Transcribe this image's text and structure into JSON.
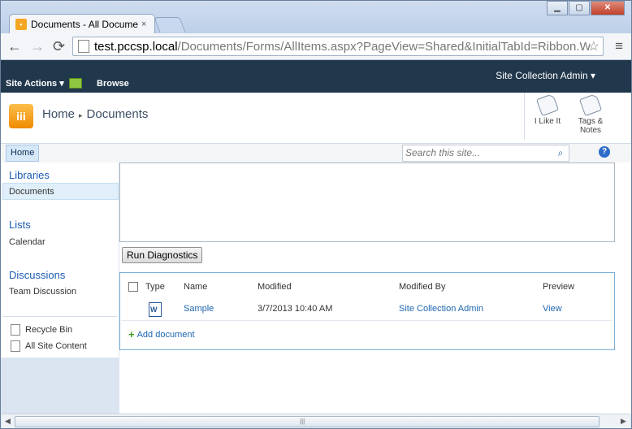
{
  "browser": {
    "tab_title": "Documents - All Documer",
    "tab_close": "×",
    "window_controls": [
      "▁",
      "▢",
      "✕"
    ],
    "url_host": "test.pccsp.local",
    "url_path": "/Documents/Forms/AllItems.aspx?PageView=Shared&InitialTabId=Ribbon.WebPar",
    "nav": {
      "back": "←",
      "forward": "→",
      "reload": "⟳",
      "star": "☆",
      "menu": "≡"
    }
  },
  "ribbon": {
    "site_actions": "Site Actions ▾",
    "browse": "Browse",
    "user": "Site Collection Admin ▾"
  },
  "header": {
    "logo_glyph": "iii",
    "breadcrumb_root": "Home",
    "breadcrumb_sep": "▸",
    "breadcrumb_current": "Documents",
    "i_like_it": "I Like It",
    "tags_notes_1": "Tags &",
    "tags_notes_2": "Notes"
  },
  "topnav": {
    "home": "Home",
    "search_placeholder": "Search this site...",
    "search_icon": "⌕",
    "help": "?"
  },
  "leftnav": {
    "libraries": "Libraries",
    "documents": "Documents",
    "lists": "Lists",
    "calendar": "Calendar",
    "discussions": "Discussions",
    "team_discussion": "Team Discussion",
    "recycle_bin": "Recycle Bin",
    "all_site_content": "All Site Content"
  },
  "main": {
    "run_diagnostics": "Run Diagnostics",
    "columns": {
      "type": "Type",
      "name": "Name",
      "modified": "Modified",
      "modified_by": "Modified By",
      "preview": "Preview"
    },
    "rows": [
      {
        "name": "Sample",
        "modified": "3/7/2013 10:40 AM",
        "modified_by": "Site Collection Admin",
        "preview": "View"
      }
    ],
    "add_document": "Add document"
  },
  "scrollbar": {
    "left": "◀",
    "right": "▶",
    "grip": "|||"
  }
}
